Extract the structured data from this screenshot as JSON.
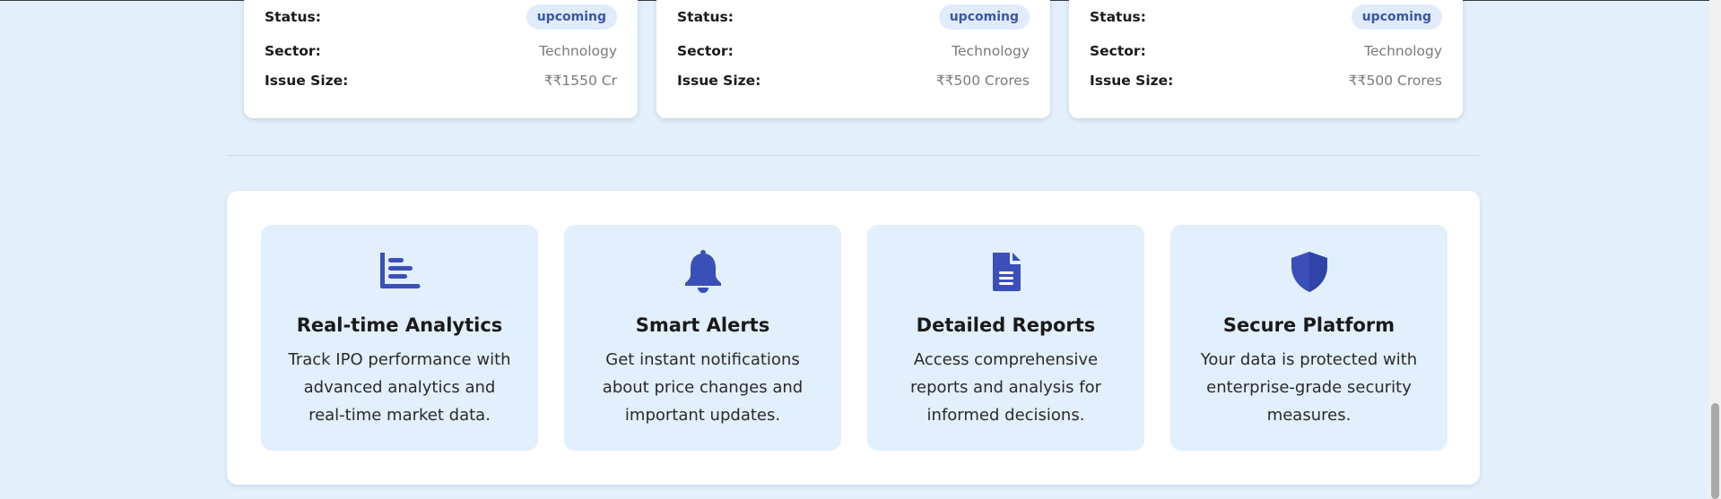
{
  "ipo_cards": [
    {
      "status_label": "Status:",
      "status": "upcoming",
      "sector_label": "Sector:",
      "sector": "Technology",
      "size_label": "Issue Size:",
      "size": "₹₹1550 Cr"
    },
    {
      "status_label": "Status:",
      "status": "upcoming",
      "sector_label": "Sector:",
      "sector": "Technology",
      "size_label": "Issue Size:",
      "size": "₹₹500 Crores"
    },
    {
      "status_label": "Status:",
      "status": "upcoming",
      "sector_label": "Sector:",
      "sector": "Technology",
      "size_label": "Issue Size:",
      "size": "₹₹500 Crores"
    }
  ],
  "features": [
    {
      "icon": "chart-bar-icon",
      "title": "Real-time Analytics",
      "description": "Track IPO performance with advanced analytics and real-time market data."
    },
    {
      "icon": "bell-icon",
      "title": "Smart Alerts",
      "description": "Get instant notifications about price changes and important updates."
    },
    {
      "icon": "document-icon",
      "title": "Detailed Reports",
      "description": "Access comprehensive reports and analysis for informed decisions."
    },
    {
      "icon": "shield-icon",
      "title": "Secure Platform",
      "description": "Your data is protected with enterprise-grade security measures."
    }
  ],
  "colors": {
    "accent": "#3b4fb8",
    "background": "#e3f0fc",
    "card": "#ffffff",
    "feature_bg": "#e2effc",
    "badge_bg": "#e0ecfb",
    "badge_text": "#3b56a8"
  }
}
